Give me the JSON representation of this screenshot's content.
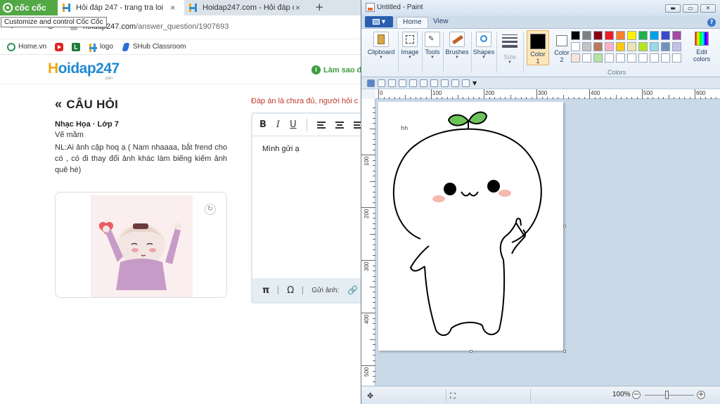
{
  "browser": {
    "brand": "cốc cốc",
    "tooltip": "Customize and control Cốc Cốc",
    "tabs": [
      {
        "title": "Hỏi đáp 247 - trang tra loi",
        "active": true
      },
      {
        "title": "Hoidap247.com - Hỏi đáp onl",
        "active": false
      }
    ],
    "new_tab": "+",
    "close": "×",
    "url_domain": "hoidap247.com",
    "url_path": "/answer_question/1907693",
    "bookmarks": [
      {
        "label": "Home.vn",
        "icon": "home-icon"
      },
      {
        "label": "",
        "icon": "youtube-icon"
      },
      {
        "label": "",
        "icon": "l-icon"
      },
      {
        "label": "logo",
        "icon": "hoidap-icon"
      },
      {
        "label": "SHub Classroom",
        "icon": "shub-icon"
      }
    ],
    "bookmark_l_letter": "L"
  },
  "site": {
    "logo_h": "H",
    "logo_rest": "oidap247",
    "logo_com": ".com",
    "help_link": "Làm sao đ",
    "question": {
      "heading": "CÂU HỎI",
      "subject": "Nhạc Họa · Lớp 7",
      "title": "Vẽ mầm",
      "body": "NL:Ai ảnh cặp hoq ạ ( Nam nhaaaa, bắt frend cho có , có đi thay đổi ảnh khác làm biếng kiếm ảnh quê hè)"
    },
    "answer": {
      "notice": "Đáp án là chưa đủ, người hỏi c",
      "editor_text": "Mình gửi ạ",
      "toolbar": {
        "bold": "B",
        "italic": "I",
        "underline": "U"
      },
      "bottom": {
        "pi": "π",
        "omega": "Ω",
        "upload": "Gửi ảnh:"
      }
    }
  },
  "paint": {
    "title": "Untitled - Paint",
    "tabs": [
      "Home",
      "View"
    ],
    "window_buttons": [
      "▬",
      "▭",
      "✕"
    ],
    "help": "?",
    "ribbon": {
      "clipboard": "Clipboard",
      "image": "Image",
      "tools": "Tools",
      "brushes": "Brushes",
      "shapes": "Shapes",
      "size": "Size",
      "color1_line1": "Color",
      "color1_line2": "1",
      "color2_line1": "Color",
      "color2_line2": "2",
      "edit_colors_line1": "Edit",
      "edit_colors_line2": "colors",
      "colors_group": "Colors"
    },
    "palette_row1": [
      "#000000",
      "#7f7f7f",
      "#880015",
      "#ed1c24",
      "#ff7f27",
      "#fff200",
      "#22b14c",
      "#00a2e8",
      "#3f48cc",
      "#a349a4"
    ],
    "palette_row2": [
      "#ffffff",
      "#c3c3c3",
      "#b97a57",
      "#ffaec9",
      "#ffc90e",
      "#efe4b0",
      "#b5e61d",
      "#99d9ea",
      "#7092be",
      "#c8bfe7"
    ],
    "palette_row3": [
      "#fbe3d8",
      "#ffffff",
      "#b5e3a0",
      "#ffffff",
      "#ffffff",
      "#ffffff",
      "#ffffff",
      "#ffffff",
      "#ffffff",
      "#ffffff"
    ],
    "color1": "#000000",
    "color2": "#ffffff",
    "ruler_h": [
      "0",
      "100",
      "200",
      "300",
      "400",
      "500",
      "600"
    ],
    "ruler_v": [
      "100",
      "200",
      "300",
      "400",
      "500"
    ],
    "canvas_text": "hh",
    "zoom": "100%",
    "zoom_minus": "−",
    "zoom_plus": "+"
  },
  "colors": {
    "leaf": "#6ec25a",
    "blush": "#f6b8b0",
    "coccoc_green": "#53a846"
  }
}
